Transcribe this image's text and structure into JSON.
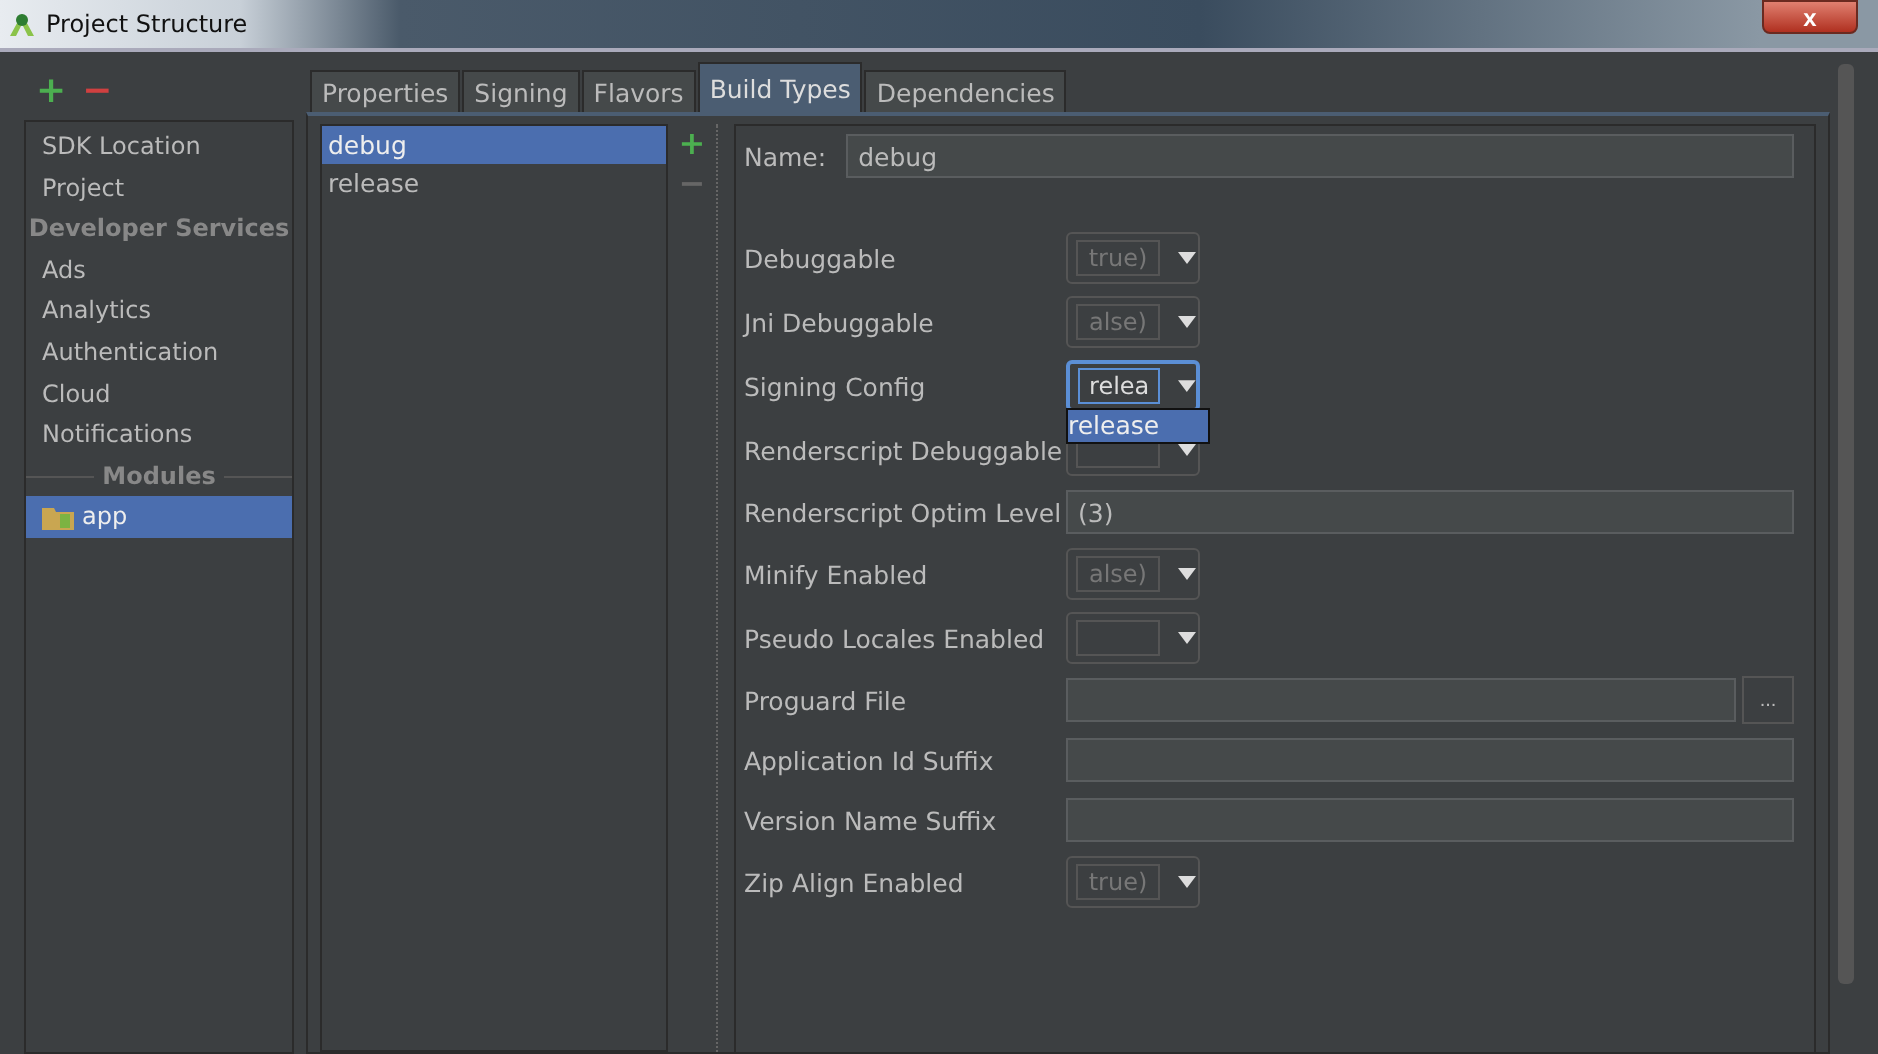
{
  "window": {
    "title": "Project Structure",
    "close": "x"
  },
  "sidebar": {
    "add": "+",
    "remove": "−",
    "items": [
      {
        "kind": "item",
        "label": "SDK Location",
        "selected": false
      },
      {
        "kind": "item",
        "label": "Project",
        "selected": false
      },
      {
        "kind": "header",
        "label": "Developer Services"
      },
      {
        "kind": "item",
        "label": "Ads",
        "selected": false
      },
      {
        "kind": "item",
        "label": "Analytics",
        "selected": false
      },
      {
        "kind": "item",
        "label": "Authentication",
        "selected": false
      },
      {
        "kind": "item",
        "label": "Cloud",
        "selected": false
      },
      {
        "kind": "item",
        "label": "Notifications",
        "selected": false
      },
      {
        "kind": "header",
        "label": "Modules"
      },
      {
        "kind": "module",
        "label": "app",
        "selected": true
      }
    ]
  },
  "tabs": [
    {
      "label": "Properties",
      "selected": false
    },
    {
      "label": "Signing",
      "selected": false
    },
    {
      "label": "Flavors",
      "selected": false
    },
    {
      "label": "Build Types",
      "selected": true
    },
    {
      "label": "Dependencies",
      "selected": false
    }
  ],
  "build_types": {
    "add": "+",
    "remove": "−",
    "items": [
      {
        "label": "debug",
        "selected": true
      },
      {
        "label": "release",
        "selected": false
      }
    ]
  },
  "form": {
    "name_label": "Name:",
    "name_value": "debug",
    "fields": [
      {
        "kind": "combo",
        "label": "Debuggable",
        "value": "true)"
      },
      {
        "kind": "combo",
        "label": "Jni Debuggable",
        "value": "alse)"
      },
      {
        "kind": "combo",
        "label": "Signing Config",
        "value": "relea",
        "focused": true,
        "options": [
          "release"
        ]
      },
      {
        "kind": "combo",
        "label": "Renderscript Debuggable"
      },
      {
        "kind": "text",
        "label": "Renderscript Optim Level",
        "value": "(3)"
      },
      {
        "kind": "combo",
        "label": "Minify Enabled",
        "value": "alse)"
      },
      {
        "kind": "combo",
        "label": "Pseudo Locales Enabled"
      },
      {
        "kind": "file",
        "label": "Proguard File",
        "browse": "..."
      },
      {
        "kind": "text",
        "label": "Application Id Suffix"
      },
      {
        "kind": "text",
        "label": "Version Name Suffix"
      },
      {
        "kind": "combo",
        "label": "Zip Align Enabled",
        "value": "true)"
      }
    ]
  }
}
